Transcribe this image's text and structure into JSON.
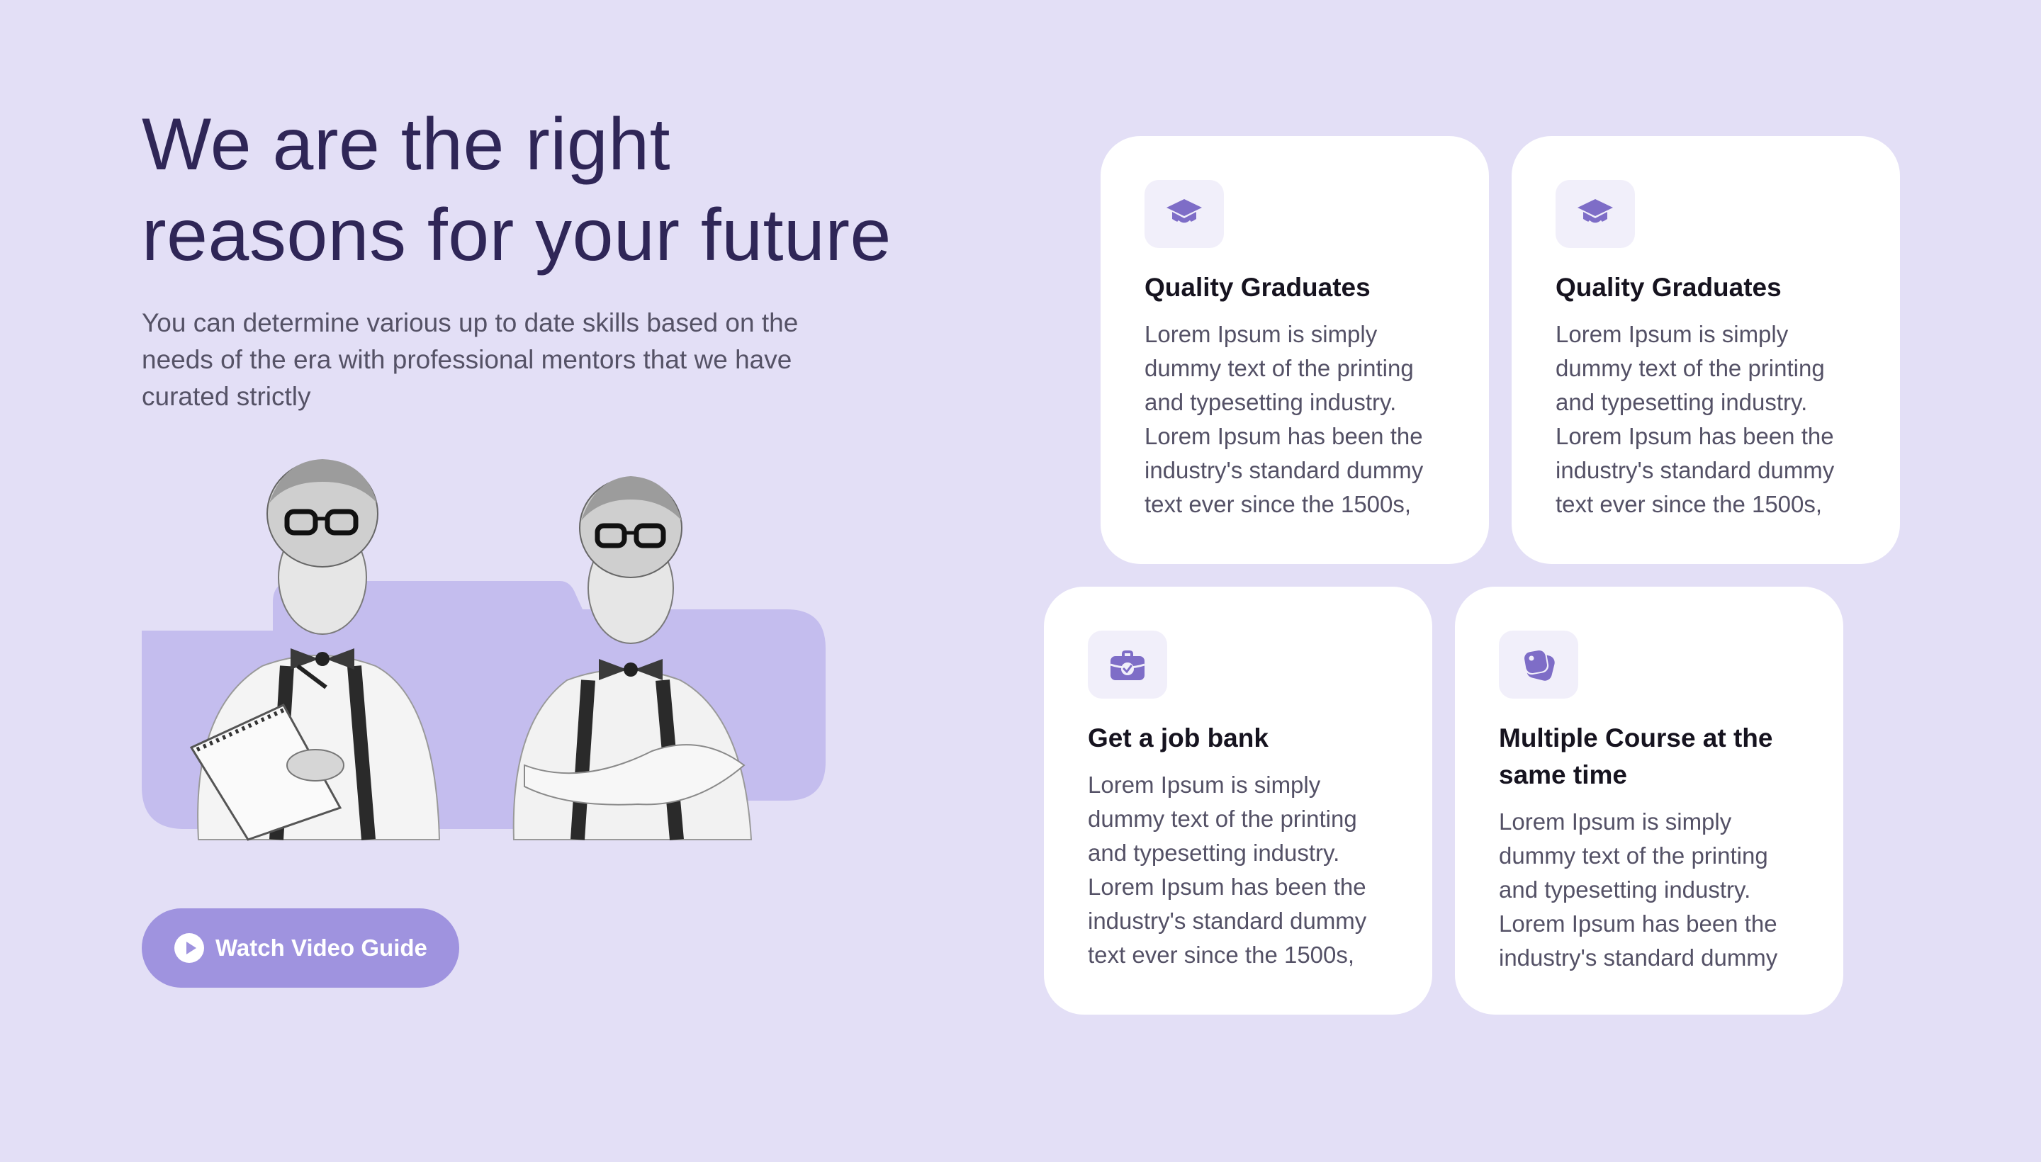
{
  "hero": {
    "title_lines": [
      "We are the right",
      "reasons for your future"
    ],
    "subtitle_lines": [
      "You can determine various up to date skills based on the",
      "needs of the era with professional mentors that we have",
      "curated strictly"
    ],
    "button_label": "Watch Video Guide"
  },
  "cards": [
    {
      "icon": "graduation-cap-icon",
      "title_lines": [
        "Quality Graduates"
      ],
      "body_lines": [
        "Lorem Ipsum is simply",
        "dummy text of the printing",
        "and typesetting industry.",
        "Lorem Ipsum has been the",
        "industry's standard dummy",
        "text ever since the 1500s,"
      ]
    },
    {
      "icon": "graduation-cap-icon",
      "title_lines": [
        "Quality Graduates"
      ],
      "body_lines": [
        "Lorem Ipsum is simply",
        "dummy text of the printing",
        "and typesetting industry.",
        "Lorem Ipsum has been the",
        "industry's standard dummy",
        "text ever since the 1500s,"
      ]
    },
    {
      "icon": "briefcase-icon",
      "title_lines": [
        "Get a job bank"
      ],
      "body_lines": [
        "Lorem Ipsum is simply",
        "dummy text of the printing",
        "and typesetting industry.",
        "Lorem Ipsum has been the",
        "industry's standard dummy",
        "text ever since the 1500s,"
      ]
    },
    {
      "icon": "layers-icon",
      "title_lines": [
        "Multiple Course at the",
        "same time"
      ],
      "body_lines": [
        "Lorem Ipsum is simply",
        "dummy text of the printing",
        "and typesetting industry.",
        "Lorem Ipsum has been the",
        "industry's standard dummy"
      ]
    }
  ],
  "colors": {
    "background": "#e3dff6",
    "heading": "#2f2657",
    "accent": "#9f93df",
    "icon": "#7e6dc7",
    "icon_tile": "#f1effa",
    "card": "#ffffff"
  }
}
